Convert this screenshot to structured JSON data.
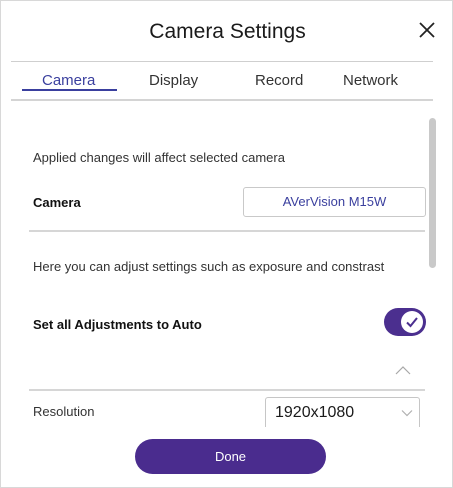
{
  "dialog": {
    "title": "Camera Settings"
  },
  "tabs": [
    {
      "label": "Camera",
      "active": true
    },
    {
      "label": "Display",
      "active": false
    },
    {
      "label": "Record",
      "active": false
    },
    {
      "label": "Network",
      "active": false
    }
  ],
  "camera_section": {
    "info_text": "Applied changes will affect selected camera",
    "camera_label": "Camera",
    "camera_value": "AVerVision M15W"
  },
  "adjust_section": {
    "info_text": "Here you can adjust settings such as exposure and constrast",
    "auto_label": "Set all Adjustments to Auto",
    "auto_enabled": true
  },
  "resolution": {
    "label": "Resolution",
    "value": "1920x1080"
  },
  "footer": {
    "done_label": "Done"
  },
  "colors": {
    "accent": "#3a3f9e",
    "toggle_on": "#4b2f8f",
    "done_button": "#4a2c8e"
  },
  "icons": {
    "close": "close-icon",
    "check": "checkmark-icon",
    "collapse": "chevron-up-icon",
    "dropdown": "chevron-down-icon"
  }
}
